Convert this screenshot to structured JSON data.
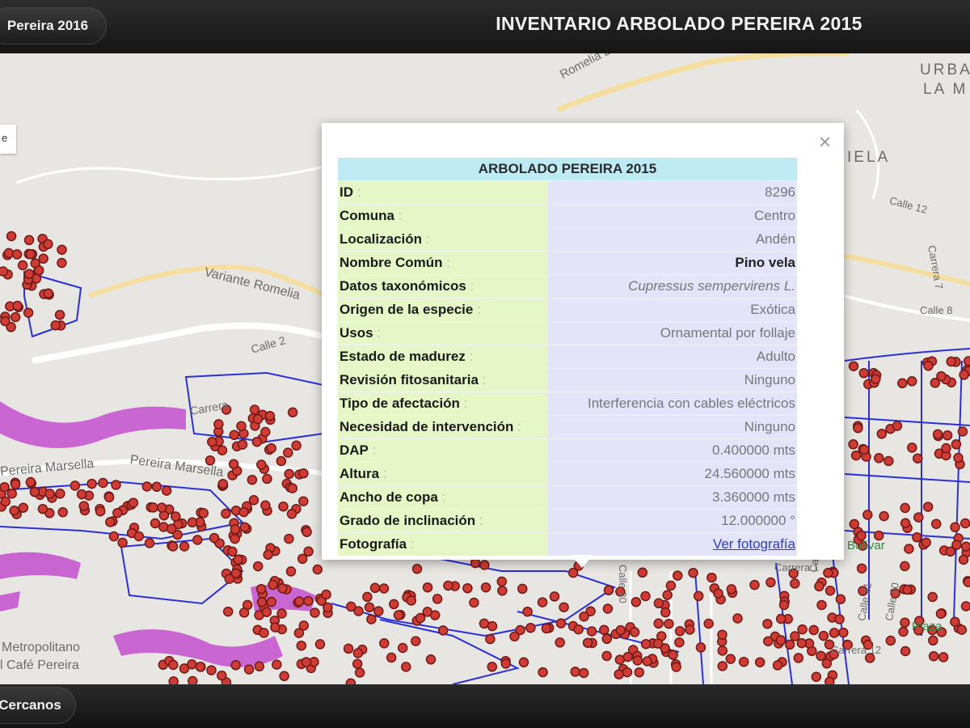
{
  "header": {
    "year_button": "Pereira 2016",
    "title": "INVENTARIO ARBOLADO PEREIRA 2015"
  },
  "footer": {
    "nearby_button": "Cercanos"
  },
  "map": {
    "layer_control_label": "e",
    "place_labels": [
      "Romelia El Pollo",
      "URBA",
      "LA M",
      "IELA",
      "Calle 12",
      "Carrera 7",
      "Variante Romelia",
      "Calle 2",
      "Calle 8",
      "Pereira Marsella",
      "Pereira Marsella",
      "Carrera",
      "Metropolitano",
      "l Café Pereira",
      "Calle 30",
      "Calle 23",
      "Calle 21",
      "Calle 20",
      "Carrera 12",
      "Carrera 1",
      "Plaza",
      "Bolívar"
    ],
    "colors": {
      "background": "#e8e6e2",
      "roads": "#ffffff",
      "highway": "#f5dea0",
      "boundaries": "#2a2fd6",
      "trees": "#cf3b35",
      "hillshade_zones": "#c44fcf"
    },
    "icons": [
      "tree-marker-icon",
      "close-icon"
    ]
  },
  "popup": {
    "title": "ARBOLADO PEREIRA 2015",
    "rows": [
      {
        "label": "ID",
        "value": "8296"
      },
      {
        "label": "Comuna",
        "value": "Centro"
      },
      {
        "label": "Localización",
        "value": "Andén"
      },
      {
        "label": "Nombre Común",
        "value": "Pino vela"
      },
      {
        "label": "Datos taxonómicos",
        "value": "Cupressus sempervirens L."
      },
      {
        "label": "Origen de la especie",
        "value": "Exótica"
      },
      {
        "label": "Usos",
        "value": "Ornamental por follaje"
      },
      {
        "label": "Estado de madurez",
        "value": "Adulto"
      },
      {
        "label": "Revisión fitosanitaria",
        "value": "Ninguno"
      },
      {
        "label": "Tipo de afectación",
        "value": "Interferencia con cables eléctricos"
      },
      {
        "label": "Necesidad de intervención",
        "value": "Ninguno"
      },
      {
        "label": "DAP",
        "value": "0.400000 mts"
      },
      {
        "label": "Altura",
        "value": "24.560000 mts"
      },
      {
        "label": "Ancho de copa",
        "value": "3.360000 mts"
      },
      {
        "label": "Grado de inclinación",
        "value": "12.000000 °"
      },
      {
        "label": "Fotografía",
        "value": "Ver fotografía"
      }
    ],
    "close_glyph": "×"
  }
}
